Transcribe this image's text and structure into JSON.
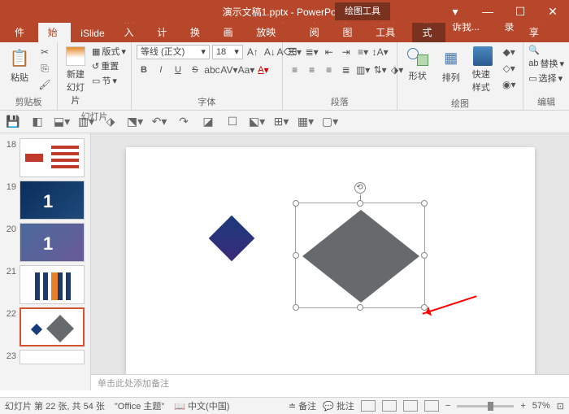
{
  "titlebar": {
    "title": "演示文稿1.pptx - PowerPoint",
    "context_tool": "绘图工具"
  },
  "tabs": {
    "file": "文件",
    "home": "开始",
    "islide": "iSlide",
    "insert": "插入",
    "design": "设计",
    "transitions": "切换",
    "animations": "动画",
    "slideshow": "幻灯片放映",
    "review": "审阅",
    "view": "视图",
    "developer": "开发工具",
    "format": "格式",
    "tellme": "告诉我...",
    "signin": "登录",
    "share": "共享"
  },
  "ribbon": {
    "clipboard": {
      "label": "剪贴板",
      "paste": "粘贴"
    },
    "slides": {
      "label": "幻灯片",
      "new": "新建\n幻灯片",
      "layout": "版式",
      "reset": "重置",
      "section": "节"
    },
    "font": {
      "label": "字体",
      "name": "等线 (正文)",
      "size": "18"
    },
    "paragraph": {
      "label": "段落"
    },
    "drawing": {
      "label": "绘图",
      "shapes": "形状",
      "arrange": "排列",
      "quick": "快速样式"
    },
    "editing": {
      "label": "编辑",
      "replace": "替换",
      "select": "选择"
    }
  },
  "thumbs": {
    "n18": "18",
    "n19": "19",
    "n20": "20",
    "n21": "21",
    "n22": "22",
    "n23": "23"
  },
  "notes_placeholder": "单击此处添加备注",
  "status": {
    "slide_info": "幻灯片 第 22 张, 共 54 张",
    "theme": "\"Office 主题\"",
    "lang": "中文(中国)",
    "notes": "备注",
    "comments": "批注",
    "zoom": "57%"
  }
}
